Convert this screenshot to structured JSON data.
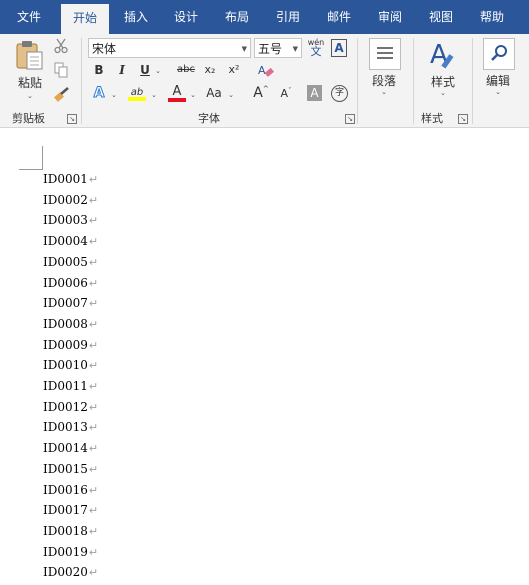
{
  "tabs": [
    "文件",
    "开始",
    "插入",
    "设计",
    "布局",
    "引用",
    "邮件",
    "审阅",
    "视图",
    "帮助"
  ],
  "active_tab": "开始",
  "clipboard": {
    "paste_label": "粘贴",
    "group_label": "剪贴板"
  },
  "font": {
    "font_name": "宋体",
    "font_size": "五号",
    "phonetic_top": "wén",
    "phonetic_bottom": "文",
    "char_border_label": "A",
    "bold": "B",
    "italic": "I",
    "underline": "U",
    "strikethrough": "abc",
    "subscript": "x₂",
    "superscript": "x²",
    "text_effects": "A",
    "highlight": "ab",
    "font_color": "A",
    "change_case": "Aa",
    "grow_font": "A",
    "shrink_font": "A",
    "char_shading": "A",
    "enclose_char": "字",
    "group_label": "字体",
    "highlight_color": "#ffff00",
    "font_color_value": "#e81123"
  },
  "paragraph": {
    "label": "段落"
  },
  "styles": {
    "label": "样式",
    "group_label": "样式"
  },
  "editing": {
    "label": "编辑"
  },
  "document": {
    "pilcrow": "↵",
    "lines": [
      "ID0001",
      "ID0002",
      "ID0003",
      "ID0004",
      "ID0005",
      "ID0006",
      "ID0007",
      "ID0008",
      "ID0009",
      "ID0010",
      "ID0011",
      "ID0012",
      "ID0013",
      "ID0014",
      "ID0015",
      "ID0016",
      "ID0017",
      "ID0018",
      "ID0019",
      "ID0020"
    ]
  },
  "colors": {
    "accent": "#2b579a",
    "ribbon_bg": "#f3f3f3"
  }
}
